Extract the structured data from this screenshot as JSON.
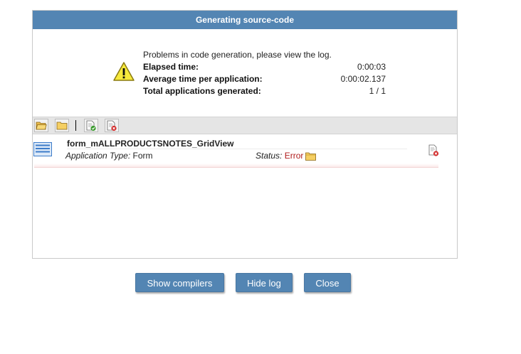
{
  "dialog": {
    "title": "Generating source-code"
  },
  "summary": {
    "message": "Problems in code generation, please view the log.",
    "elapsed_label": "Elapsed time:",
    "elapsed_value": "0:00:03",
    "average_label": "Average time per application:",
    "average_value": "0:00:02.137",
    "total_label": "Total applications generated:",
    "total_value": "1 / 1",
    "icon": "warning-icon"
  },
  "toolbar": {
    "icons": [
      "open-folder-icon",
      "folder-icon",
      "success-document-icon",
      "error-document-icon"
    ]
  },
  "application": {
    "name": "form_mALLPRODUCTSNOTES_GridView",
    "type_label": "Application Type:",
    "type_value": "Form",
    "status_label": "Status:",
    "status_value": "Error",
    "icon": "grid-view-icon",
    "log_icon": "error-document-icon"
  },
  "buttons": {
    "show_compilers": "Show compilers",
    "hide_log": "Hide log",
    "close": "Close"
  },
  "colors": {
    "header_bg": "#5385b3",
    "button_bg": "#5385b3",
    "toolbar_bg": "#e5e5e5",
    "error_text": "#b01c1c"
  }
}
